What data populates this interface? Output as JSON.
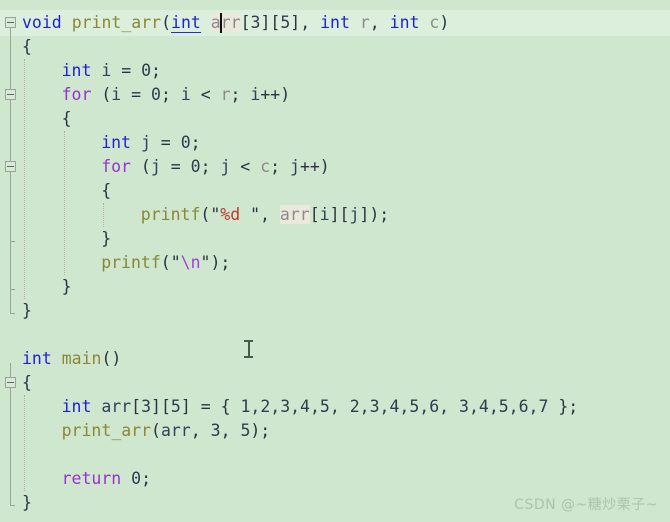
{
  "app": {
    "kind": "code-editor",
    "language": "C",
    "theme": "light-green",
    "background_color": "#cfe6cf",
    "current_line_color": "#dcefdc"
  },
  "colors": {
    "keyword": "#1f1fd8",
    "control_keyword": "#9b30d0",
    "function_name": "#8a8736",
    "identifier": "#31425c",
    "parameter": "#8c8c8c",
    "number": "#2e3c4f",
    "string_punctuation": "#2b3340",
    "format_specifier": "#c0392b",
    "escape_sequence": "#a63fd9",
    "reference_highlight": "#ece8dc",
    "gutter_line": "#9aa39a",
    "indent_guide": "#c0a9a9",
    "watermark": "#a9c6a9"
  },
  "editor": {
    "caret": {
      "line": 1,
      "column_after_text": "a"
    },
    "mouse_cursor": "i-beam-text-cursor"
  },
  "gutter": {
    "fold_markers": [
      {
        "line": 1,
        "state": "expanded",
        "glyph": "minus-box"
      },
      {
        "line": 4,
        "state": "expanded",
        "glyph": "minus-box"
      },
      {
        "line": 7,
        "state": "expanded",
        "glyph": "minus-box"
      },
      {
        "line": 16,
        "state": "expanded",
        "glyph": "minus-box"
      }
    ]
  },
  "code": {
    "lines": [
      {
        "n": 1,
        "current": true,
        "indent": 0,
        "tokens": [
          {
            "t": "void",
            "c": "kw"
          },
          {
            "t": " ",
            "c": "punct"
          },
          {
            "t": "print_arr",
            "c": "fn"
          },
          {
            "t": "(",
            "c": "punct"
          },
          {
            "t": "int",
            "c": "kw uline"
          },
          {
            "t": " ",
            "c": "punct"
          },
          {
            "t": "arr",
            "c": "param ref-hl"
          },
          {
            "t": "[",
            "c": "punct"
          },
          {
            "t": "3",
            "c": "num"
          },
          {
            "t": "]",
            "c": "punct"
          },
          {
            "t": "[",
            "c": "punct"
          },
          {
            "t": "5",
            "c": "num"
          },
          {
            "t": "]",
            "c": "punct"
          },
          {
            "t": ", ",
            "c": "punct"
          },
          {
            "t": "int",
            "c": "kw"
          },
          {
            "t": " ",
            "c": "punct"
          },
          {
            "t": "r",
            "c": "param"
          },
          {
            "t": ", ",
            "c": "punct"
          },
          {
            "t": "int",
            "c": "kw"
          },
          {
            "t": " ",
            "c": "punct"
          },
          {
            "t": "c",
            "c": "param"
          },
          {
            "t": ")",
            "c": "punct"
          }
        ]
      },
      {
        "n": 2,
        "indent": 0,
        "tokens": [
          {
            "t": "{",
            "c": "brace"
          }
        ]
      },
      {
        "n": 3,
        "indent": 1,
        "tokens": [
          {
            "t": "int",
            "c": "kw"
          },
          {
            "t": " ",
            "c": "punct"
          },
          {
            "t": "i",
            "c": "ident"
          },
          {
            "t": " = ",
            "c": "punct"
          },
          {
            "t": "0",
            "c": "num"
          },
          {
            "t": ";",
            "c": "punct"
          }
        ]
      },
      {
        "n": 4,
        "indent": 1,
        "tokens": [
          {
            "t": "for",
            "c": "kw-ctl"
          },
          {
            "t": " (",
            "c": "punct"
          },
          {
            "t": "i",
            "c": "ident"
          },
          {
            "t": " = ",
            "c": "punct"
          },
          {
            "t": "0",
            "c": "num"
          },
          {
            "t": "; ",
            "c": "punct"
          },
          {
            "t": "i",
            "c": "ident"
          },
          {
            "t": " < ",
            "c": "punct"
          },
          {
            "t": "r",
            "c": "param"
          },
          {
            "t": "; ",
            "c": "punct"
          },
          {
            "t": "i",
            "c": "ident"
          },
          {
            "t": "++)",
            "c": "punct"
          }
        ]
      },
      {
        "n": 5,
        "indent": 1,
        "tokens": [
          {
            "t": "{",
            "c": "brace"
          }
        ]
      },
      {
        "n": 6,
        "indent": 2,
        "tokens": [
          {
            "t": "int",
            "c": "kw"
          },
          {
            "t": " ",
            "c": "punct"
          },
          {
            "t": "j",
            "c": "ident"
          },
          {
            "t": " = ",
            "c": "punct"
          },
          {
            "t": "0",
            "c": "num"
          },
          {
            "t": ";",
            "c": "punct"
          }
        ]
      },
      {
        "n": 7,
        "indent": 2,
        "tokens": [
          {
            "t": "for",
            "c": "kw-ctl"
          },
          {
            "t": " (",
            "c": "punct"
          },
          {
            "t": "j",
            "c": "ident"
          },
          {
            "t": " = ",
            "c": "punct"
          },
          {
            "t": "0",
            "c": "num"
          },
          {
            "t": "; ",
            "c": "punct"
          },
          {
            "t": "j",
            "c": "ident"
          },
          {
            "t": " < ",
            "c": "punct"
          },
          {
            "t": "c",
            "c": "param"
          },
          {
            "t": "; ",
            "c": "punct"
          },
          {
            "t": "j",
            "c": "ident"
          },
          {
            "t": "++)",
            "c": "punct"
          }
        ]
      },
      {
        "n": 8,
        "indent": 2,
        "tokens": [
          {
            "t": "{",
            "c": "brace"
          }
        ]
      },
      {
        "n": 9,
        "indent": 3,
        "tokens": [
          {
            "t": "printf",
            "c": "fn"
          },
          {
            "t": "(",
            "c": "punct"
          },
          {
            "t": "\"",
            "c": "str"
          },
          {
            "t": "%d",
            "c": "str-fmt"
          },
          {
            "t": " ",
            "c": "str"
          },
          {
            "t": "\"",
            "c": "str"
          },
          {
            "t": ", ",
            "c": "punct"
          },
          {
            "t": "arr",
            "c": "param ref-hl"
          },
          {
            "t": "[",
            "c": "punct"
          },
          {
            "t": "i",
            "c": "ident"
          },
          {
            "t": "][",
            "c": "punct"
          },
          {
            "t": "j",
            "c": "ident"
          },
          {
            "t": "]);",
            "c": "punct"
          }
        ]
      },
      {
        "n": 10,
        "indent": 2,
        "tokens": [
          {
            "t": "}",
            "c": "brace"
          }
        ]
      },
      {
        "n": 11,
        "indent": 2,
        "tokens": [
          {
            "t": "printf",
            "c": "fn"
          },
          {
            "t": "(",
            "c": "punct"
          },
          {
            "t": "\"",
            "c": "str"
          },
          {
            "t": "\\n",
            "c": "str-esc"
          },
          {
            "t": "\"",
            "c": "str"
          },
          {
            "t": ");",
            "c": "punct"
          }
        ]
      },
      {
        "n": 12,
        "indent": 1,
        "tokens": [
          {
            "t": "}",
            "c": "brace"
          }
        ]
      },
      {
        "n": 13,
        "indent": 0,
        "tokens": [
          {
            "t": "}",
            "c": "brace"
          }
        ]
      },
      {
        "n": 14,
        "indent": 0,
        "tokens": []
      },
      {
        "n": 15,
        "indent": 0,
        "tokens": [
          {
            "t": "int",
            "c": "kw"
          },
          {
            "t": " ",
            "c": "punct"
          },
          {
            "t": "main",
            "c": "fn"
          },
          {
            "t": "()",
            "c": "punct"
          }
        ]
      },
      {
        "n": 16,
        "indent": 0,
        "tokens": [
          {
            "t": "{",
            "c": "brace"
          }
        ]
      },
      {
        "n": 17,
        "indent": 1,
        "tokens": [
          {
            "t": "int",
            "c": "kw"
          },
          {
            "t": " ",
            "c": "punct"
          },
          {
            "t": "arr",
            "c": "ident"
          },
          {
            "t": "[",
            "c": "punct"
          },
          {
            "t": "3",
            "c": "num"
          },
          {
            "t": "][",
            "c": "punct"
          },
          {
            "t": "5",
            "c": "num"
          },
          {
            "t": "] = { ",
            "c": "punct"
          },
          {
            "t": "1,2,3,4,5,",
            "c": "num"
          },
          {
            "t": " ",
            "c": "punct"
          },
          {
            "t": "2,3,4,5,6,",
            "c": "num"
          },
          {
            "t": " ",
            "c": "punct"
          },
          {
            "t": "3,4,5,6,7",
            "c": "num"
          },
          {
            "t": " };",
            "c": "punct"
          }
        ]
      },
      {
        "n": 18,
        "indent": 1,
        "tokens": [
          {
            "t": "print_arr",
            "c": "fn"
          },
          {
            "t": "(",
            "c": "punct"
          },
          {
            "t": "arr",
            "c": "ident"
          },
          {
            "t": ", ",
            "c": "punct"
          },
          {
            "t": "3",
            "c": "num"
          },
          {
            "t": ", ",
            "c": "punct"
          },
          {
            "t": "5",
            "c": "num"
          },
          {
            "t": ");",
            "c": "punct"
          }
        ]
      },
      {
        "n": 19,
        "indent": 0,
        "tokens": []
      },
      {
        "n": 20,
        "indent": 1,
        "tokens": [
          {
            "t": "return",
            "c": "kw-ctl"
          },
          {
            "t": " ",
            "c": "punct"
          },
          {
            "t": "0",
            "c": "num"
          },
          {
            "t": ";",
            "c": "punct"
          }
        ]
      },
      {
        "n": 21,
        "indent": 0,
        "tokens": [
          {
            "t": "}",
            "c": "brace"
          }
        ]
      }
    ]
  },
  "watermark": {
    "text": "CSDN @~糖炒栗子~"
  }
}
